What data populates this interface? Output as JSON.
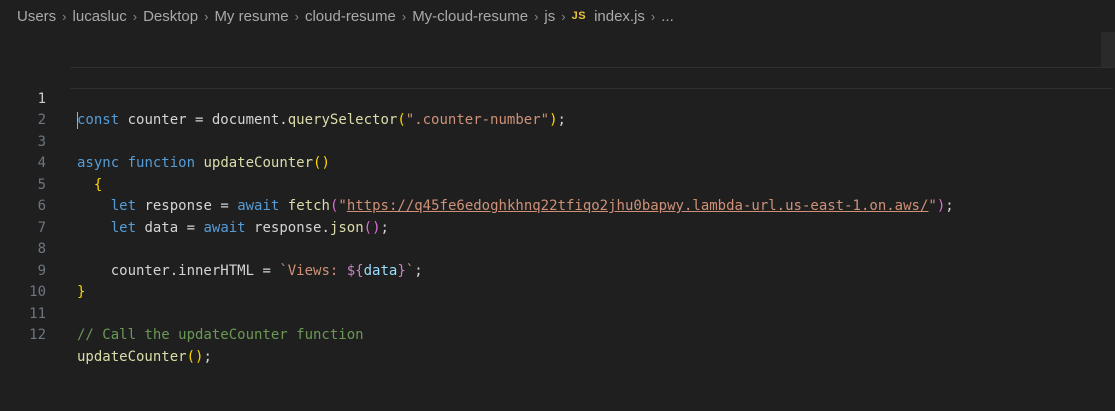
{
  "breadcrumb": {
    "items": [
      "Users",
      "lucasluc",
      "Desktop",
      "My resume",
      "cloud-resume",
      "My-cloud-resume",
      "js"
    ],
    "file_icon": "JS",
    "file_name": "index.js",
    "trailing": "..."
  },
  "editor": {
    "lines": [
      {
        "num": "1",
        "t": [
          "const",
          " counter ",
          "=",
          " document.",
          "querySelector",
          "(",
          "\".counter-number\"",
          ")",
          ";"
        ]
      },
      {
        "num": "2",
        "t": []
      },
      {
        "num": "3",
        "t": [
          "async",
          " ",
          "function",
          " ",
          "updateCounter",
          "()",
          ""
        ]
      },
      {
        "num": "4",
        "t": [
          "  {"
        ]
      },
      {
        "num": "5",
        "t": [
          "    let",
          " response ",
          "=",
          " ",
          "await",
          " ",
          "fetch",
          "(",
          "\"",
          "https://q45fe6edoghkhnq22tfiqo2jhu0bapwy.lambda-url.us-east-1.on.aws/",
          "\"",
          ")",
          ";"
        ]
      },
      {
        "num": "6",
        "t": [
          "    let",
          " data ",
          "=",
          " ",
          "await",
          " response.",
          "json",
          "()",
          ";"
        ]
      },
      {
        "num": "7",
        "t": []
      },
      {
        "num": "8",
        "t": [
          "    counter.innerHTML ",
          "=",
          " ",
          "`Views: ",
          "${",
          "data",
          "}",
          "`",
          ";"
        ]
      },
      {
        "num": "9",
        "t": [
          "}"
        ]
      },
      {
        "num": "10",
        "t": []
      },
      {
        "num": "11",
        "t": [
          "// Call the updateCounter function"
        ]
      },
      {
        "num": "12",
        "t": [
          "updateCounter",
          "()",
          ";"
        ]
      }
    ]
  },
  "icons": [
    "chevron-right-icon",
    "js-file-icon"
  ]
}
